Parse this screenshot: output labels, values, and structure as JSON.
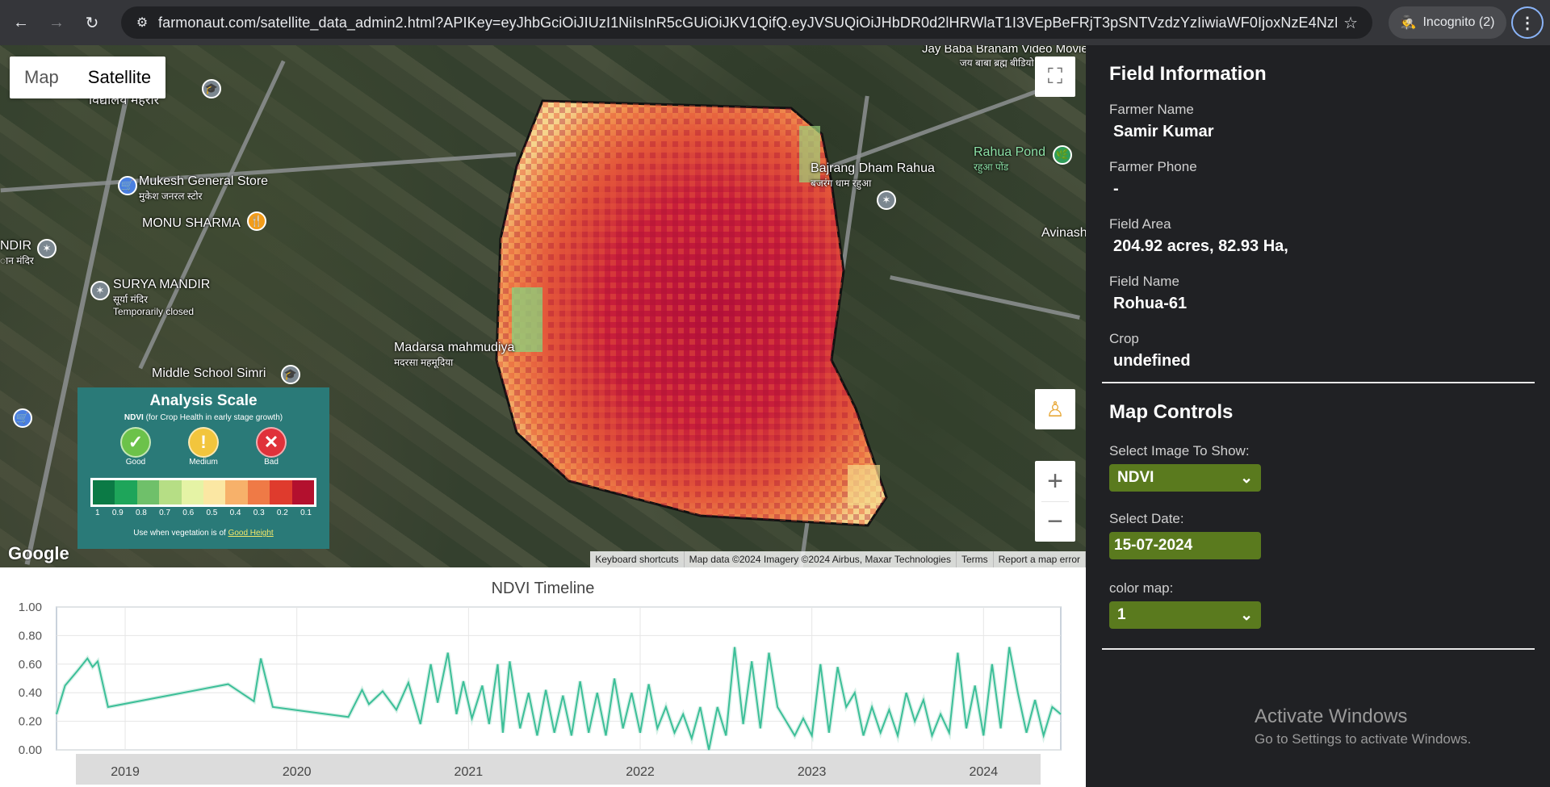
{
  "browser": {
    "url": "farmonaut.com/satellite_data_admin2.html?APIKey=eyJhbGciOiJIUzI1NiIsInR5cGUiOiJKV1QifQ.eyJVSUQiOiJHbDR0d2lHRWlaT1I3VEpBeFRjT3pSNTVzdzYzIiwiaWF0IjoxNzE4NzEyOTE5fQ.P18...",
    "incognito_label": "Incognito (2)"
  },
  "map": {
    "toggle_map": "Map",
    "toggle_satellite": "Satellite",
    "pois": [
      {
        "name": "Mukesh General Store",
        "sub": "मुकेश जनरल स्टोर"
      },
      {
        "name": "MONU SHARMA",
        "sub": ""
      },
      {
        "name": "SURYA MANDIR",
        "sub": "सूर्या मंदिर",
        "extra": "Temporarily closed"
      },
      {
        "name": "Madarsa mahmudiya",
        "sub": "मदरसा महमूदिया"
      },
      {
        "name": "Middle School Simri",
        "sub": ""
      },
      {
        "name": "Bajrang Dham Rahua",
        "sub": "बजरंग धाम रहुआ"
      },
      {
        "name": "Rahua Pond",
        "sub": "रहुआ पोंड"
      },
      {
        "name": "Jay Baba Branam Video Movie",
        "sub": "जय बाबा ब्रह्म बीडियो मूवी"
      },
      {
        "name": "Avinash",
        "sub": ""
      },
      {
        "name": "NDIR",
        "sub": "ान मंदिर"
      },
      {
        "name": "विद्यालय मेहरौर",
        "sub": ""
      }
    ],
    "google_logo": "Google",
    "attribution": [
      "Keyboard shortcuts",
      "Map data ©2024 Imagery ©2024 Airbus, Maxar Technologies",
      "Terms",
      "Report a map error"
    ]
  },
  "legend": {
    "title": "Analysis Scale",
    "subtitle_bold": "NDVI",
    "subtitle": " (for Crop Health in early stage growth)",
    "good": "Good",
    "medium": "Medium",
    "bad": "Bad",
    "ticks": [
      "1",
      "0.9",
      "0.8",
      "0.7",
      "0.6",
      "0.5",
      "0.4",
      "0.3",
      "0.2",
      "0.1"
    ],
    "colors": [
      "#0b7a45",
      "#1ea55a",
      "#6fc06a",
      "#b6de85",
      "#e5f3a5",
      "#fbe7a3",
      "#f7b16a",
      "#ef7a46",
      "#df3b2d",
      "#b3102e"
    ],
    "note": "Use when vegetation is of ",
    "note_link": "Good Height"
  },
  "chart_data": {
    "type": "line",
    "title": "NDVI Timeline",
    "ylim": [
      0,
      1
    ],
    "yticks": [
      "1.00",
      "0.80",
      "0.60",
      "0.40",
      "0.20",
      "0.00"
    ],
    "xticks": [
      "2019",
      "2020",
      "2021",
      "2022",
      "2023",
      "2024"
    ],
    "x_range": [
      2018.6,
      2024.45
    ],
    "series": [
      {
        "color": "#3cbf98",
        "points": [
          [
            2018.6,
            0.25
          ],
          [
            2018.65,
            0.45
          ],
          [
            2018.72,
            0.55
          ],
          [
            2018.78,
            0.64
          ],
          [
            2018.81,
            0.58
          ],
          [
            2018.84,
            0.62
          ],
          [
            2018.87,
            0.46
          ],
          [
            2018.9,
            0.3
          ],
          [
            2019.6,
            0.46
          ],
          [
            2019.75,
            0.34
          ],
          [
            2019.79,
            0.64
          ],
          [
            2019.86,
            0.3
          ],
          [
            2020.3,
            0.23
          ],
          [
            2020.38,
            0.42
          ],
          [
            2020.42,
            0.32
          ],
          [
            2020.5,
            0.41
          ],
          [
            2020.58,
            0.28
          ],
          [
            2020.65,
            0.47
          ],
          [
            2020.72,
            0.18
          ],
          [
            2020.78,
            0.6
          ],
          [
            2020.82,
            0.33
          ],
          [
            2020.88,
            0.68
          ],
          [
            2020.93,
            0.25
          ],
          [
            2020.97,
            0.48
          ],
          [
            2021.02,
            0.22
          ],
          [
            2021.08,
            0.45
          ],
          [
            2021.12,
            0.18
          ],
          [
            2021.17,
            0.6
          ],
          [
            2021.2,
            0.12
          ],
          [
            2021.24,
            0.62
          ],
          [
            2021.3,
            0.15
          ],
          [
            2021.35,
            0.4
          ],
          [
            2021.4,
            0.1
          ],
          [
            2021.45,
            0.42
          ],
          [
            2021.5,
            0.12
          ],
          [
            2021.55,
            0.38
          ],
          [
            2021.6,
            0.1
          ],
          [
            2021.65,
            0.48
          ],
          [
            2021.7,
            0.12
          ],
          [
            2021.75,
            0.4
          ],
          [
            2021.8,
            0.1
          ],
          [
            2021.85,
            0.5
          ],
          [
            2021.9,
            0.15
          ],
          [
            2021.95,
            0.4
          ],
          [
            2022.0,
            0.12
          ],
          [
            2022.05,
            0.46
          ],
          [
            2022.1,
            0.15
          ],
          [
            2022.15,
            0.3
          ],
          [
            2022.2,
            0.12
          ],
          [
            2022.25,
            0.25
          ],
          [
            2022.3,
            0.08
          ],
          [
            2022.35,
            0.3
          ],
          [
            2022.4,
            0.0
          ],
          [
            2022.45,
            0.3
          ],
          [
            2022.5,
            0.1
          ],
          [
            2022.55,
            0.72
          ],
          [
            2022.6,
            0.18
          ],
          [
            2022.65,
            0.62
          ],
          [
            2022.7,
            0.15
          ],
          [
            2022.75,
            0.68
          ],
          [
            2022.8,
            0.3
          ],
          [
            2022.85,
            0.2
          ],
          [
            2022.9,
            0.1
          ],
          [
            2022.95,
            0.22
          ],
          [
            2023.0,
            0.1
          ],
          [
            2023.05,
            0.6
          ],
          [
            2023.1,
            0.12
          ],
          [
            2023.15,
            0.58
          ],
          [
            2023.2,
            0.3
          ],
          [
            2023.25,
            0.4
          ],
          [
            2023.3,
            0.1
          ],
          [
            2023.35,
            0.3
          ],
          [
            2023.4,
            0.12
          ],
          [
            2023.45,
            0.28
          ],
          [
            2023.5,
            0.1
          ],
          [
            2023.55,
            0.4
          ],
          [
            2023.6,
            0.2
          ],
          [
            2023.65,
            0.35
          ],
          [
            2023.7,
            0.1
          ],
          [
            2023.75,
            0.25
          ],
          [
            2023.8,
            0.12
          ],
          [
            2023.85,
            0.68
          ],
          [
            2023.9,
            0.15
          ],
          [
            2023.95,
            0.45
          ],
          [
            2024.0,
            0.1
          ],
          [
            2024.05,
            0.6
          ],
          [
            2024.1,
            0.15
          ],
          [
            2024.15,
            0.72
          ],
          [
            2024.2,
            0.4
          ],
          [
            2024.25,
            0.12
          ],
          [
            2024.3,
            0.35
          ],
          [
            2024.35,
            0.1
          ],
          [
            2024.4,
            0.3
          ],
          [
            2024.45,
            0.25
          ]
        ]
      }
    ]
  },
  "panel": {
    "field_info_title": "Field Information",
    "farmer_name_label": "Farmer Name",
    "farmer_name": "Samir Kumar",
    "farmer_phone_label": "Farmer Phone",
    "farmer_phone": "-",
    "field_area_label": "Field Area",
    "field_area": "204.92 acres, 82.93 Ha,",
    "field_name_label": "Field Name",
    "field_name": "Rohua-61",
    "crop_label": "Crop",
    "crop": "undefined",
    "map_controls_title": "Map Controls",
    "select_image_label": "Select Image To Show:",
    "select_image_value": "NDVI",
    "select_date_label": "Select Date:",
    "select_date_value": "15-07-2024",
    "color_map_label": "color map:",
    "color_map_value": "1",
    "watermark_title": "Activate Windows",
    "watermark_sub": "Go to Settings to activate Windows."
  }
}
